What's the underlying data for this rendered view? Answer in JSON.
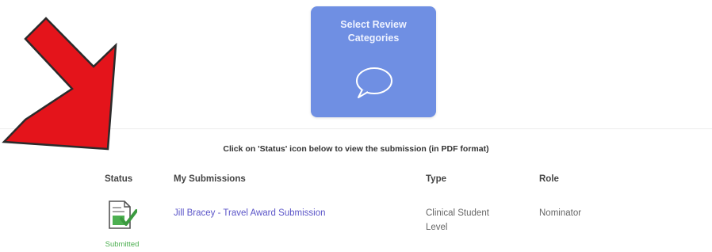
{
  "review_card": {
    "title": "Select Review\nCategories",
    "icon": "speech-bubble-icon",
    "color": "#6f8fe3"
  },
  "instruction": "Click on 'Status' icon below to view the submission (in PDF format)",
  "table": {
    "headers": {
      "status": "Status",
      "submissions": "My Submissions",
      "type": "Type",
      "role": "Role"
    },
    "rows": [
      {
        "status_icon": "document-check-icon",
        "status": "Submitted",
        "submission": "Jill Bracey - Travel Award Submission",
        "type": "Clinical Student\nLevel",
        "role": "Nominator"
      }
    ]
  },
  "annotation": {
    "icon": "red-arrow-icon",
    "color": "#e4141b"
  },
  "colors": {
    "link": "#5b55c8",
    "status_submitted": "#4caf50"
  }
}
